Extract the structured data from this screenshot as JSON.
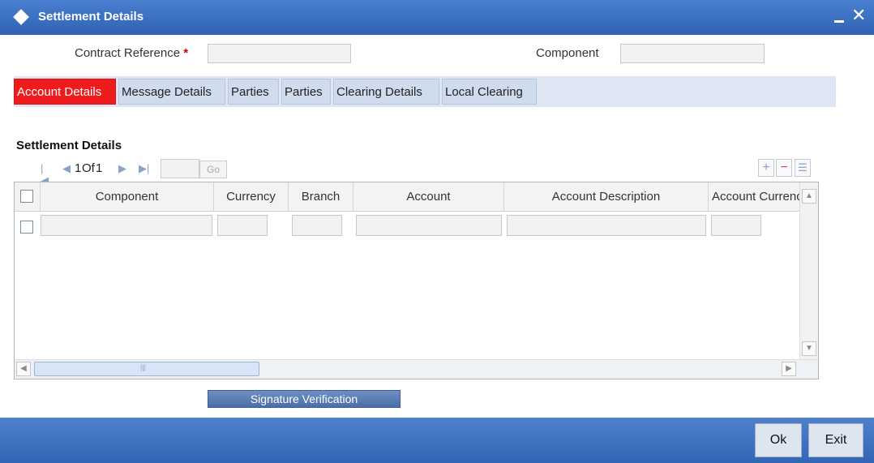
{
  "window": {
    "title": "Settlement Details"
  },
  "header": {
    "contract_reference_label": "Contract Reference",
    "required_mark": "*",
    "component_label": "Component"
  },
  "tabs": [
    {
      "label": "Account Details",
      "active": true
    },
    {
      "label": "Message Details"
    },
    {
      "label": "Parties"
    },
    {
      "label": "Parties"
    },
    {
      "label": "Clearing Details"
    },
    {
      "label": "Local Clearing"
    }
  ],
  "section": {
    "title": "Settlement Details"
  },
  "pager": {
    "current": "1",
    "of_label": "Of",
    "total": "1",
    "go_label": "Go"
  },
  "grid": {
    "columns": [
      "Component",
      "Currency",
      "Branch",
      "Account",
      "Account Description",
      "Account Currency"
    ],
    "rows": [
      {
        "checked": false,
        "values": [
          "",
          "",
          "",
          "",
          "",
          ""
        ]
      }
    ]
  },
  "buttons": {
    "signature_verification": "Signature Verification",
    "ok": "Ok",
    "exit": "Exit"
  },
  "colors": {
    "titlebar": "#3468ba",
    "active_tab": "#ee1c1c",
    "tab_bg": "#cfdcee",
    "footer": "#3a6cbb"
  },
  "icons": [
    "diamond-icon",
    "minimize-icon",
    "close-icon",
    "first-page-icon",
    "prev-page-icon",
    "next-page-icon",
    "last-page-icon",
    "add-row-icon",
    "delete-row-icon",
    "single-view-icon"
  ]
}
